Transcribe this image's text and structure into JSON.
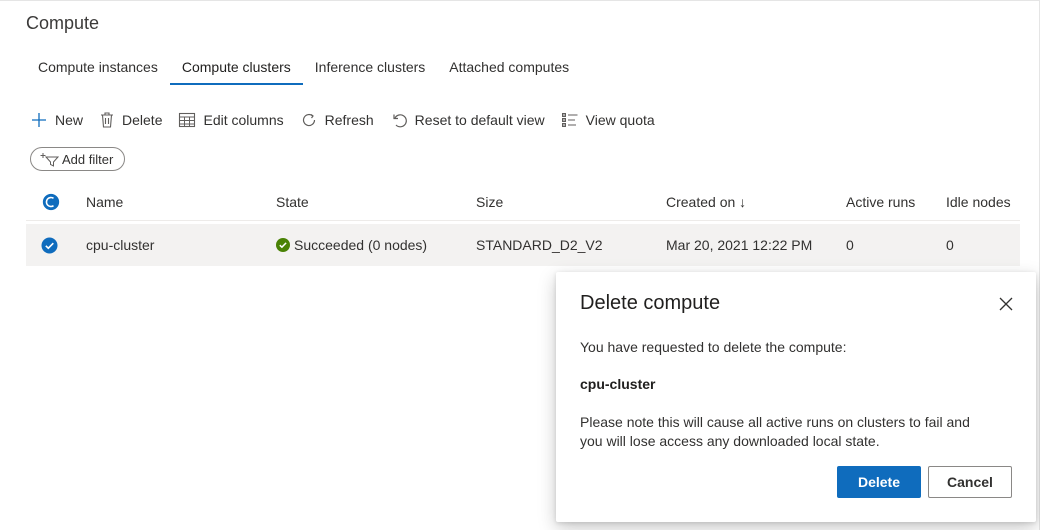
{
  "page": {
    "title": "Compute"
  },
  "tabs": [
    {
      "label": "Compute instances"
    },
    {
      "label": "Compute clusters",
      "active": true
    },
    {
      "label": "Inference clusters"
    },
    {
      "label": "Attached computes"
    }
  ],
  "toolbar": {
    "new_label": "New",
    "delete_label": "Delete",
    "edit_columns_label": "Edit columns",
    "refresh_label": "Refresh",
    "reset_label": "Reset to default view",
    "quota_label": "View quota"
  },
  "filter": {
    "add_label": "Add filter"
  },
  "table": {
    "columns": [
      "Name",
      "State",
      "Size",
      "Created on ↓",
      "Active runs",
      "Idle nodes"
    ],
    "rows": [
      {
        "selected": true,
        "name": "cpu-cluster",
        "state": "Succeeded (0 nodes)",
        "size": "STANDARD_D2_V2",
        "created_on": "Mar 20, 2021 12:22 PM",
        "active_runs": "0",
        "idle_nodes": "0"
      }
    ]
  },
  "dialog": {
    "title": "Delete compute",
    "message": "You have requested to delete the compute:",
    "target_name": "cpu-cluster",
    "warning": "Please note this will cause all active runs on clusters to fail and you will lose access any downloaded local state.",
    "confirm_label": "Delete",
    "cancel_label": "Cancel"
  },
  "colors": {
    "accent": "#0f6cbd",
    "success": "#498205",
    "row_selected": "#f3f2f1"
  }
}
